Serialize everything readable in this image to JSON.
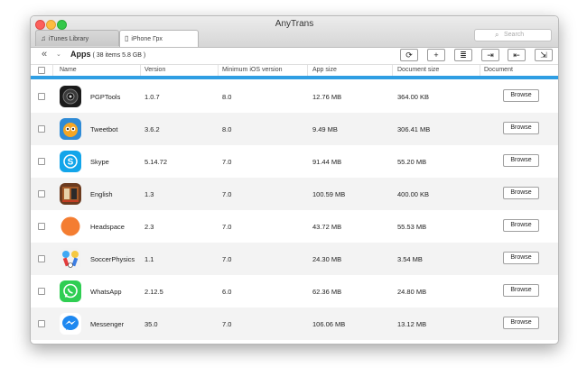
{
  "window": {
    "title": "AnyTrans"
  },
  "search": {
    "placeholder": "Search",
    "icon": "magnifier-icon"
  },
  "tabs": [
    {
      "label": "iTunes Library",
      "icon": "music-note-icon"
    },
    {
      "label": "iPhone Грх",
      "icon": "iphone-icon"
    }
  ],
  "toolbar": {
    "title": "Apps",
    "meta": "( 38 items  5.8 GB )",
    "buttons": [
      "refresh-icon",
      "add-icon",
      "list-icon",
      "import-icon",
      "export-icon",
      "transfer-icon"
    ]
  },
  "columns": [
    "Name",
    "Version",
    "Minimum iOS version",
    "App size",
    "Document size",
    "Document"
  ],
  "browse_label": "Browse",
  "accent_color": "#2f9ee3",
  "rows": [
    {
      "name": "PGPTools",
      "version": "1.0.7",
      "min_ios": "8.0",
      "app_size": "12.76 MB",
      "doc_size": "364.00 KB",
      "icon": "pgptools-icon"
    },
    {
      "name": "Tweetbot",
      "version": "3.6.2",
      "min_ios": "8.0",
      "app_size": "9.49 MB",
      "doc_size": "306.41 MB",
      "icon": "tweetbot-icon"
    },
    {
      "name": "Skype",
      "version": "5.14.72",
      "min_ios": "7.0",
      "app_size": "91.44 MB",
      "doc_size": "55.20 MB",
      "icon": "skype-icon"
    },
    {
      "name": "English",
      "version": "1.3",
      "min_ios": "7.0",
      "app_size": "100.59 MB",
      "doc_size": "400.00 KB",
      "icon": "english-icon"
    },
    {
      "name": "Headspace",
      "version": "2.3",
      "min_ios": "7.0",
      "app_size": "43.72 MB",
      "doc_size": "55.53 MB",
      "icon": "headspace-icon"
    },
    {
      "name": "SoccerPhysics",
      "version": "1.1",
      "min_ios": "7.0",
      "app_size": "24.30 MB",
      "doc_size": "3.54 MB",
      "icon": "soccerphysics-icon"
    },
    {
      "name": "WhatsApp",
      "version": "2.12.5",
      "min_ios": "6.0",
      "app_size": "62.36 MB",
      "doc_size": "24.80 MB",
      "icon": "whatsapp-icon"
    },
    {
      "name": "Messenger",
      "version": "35.0",
      "min_ios": "7.0",
      "app_size": "106.06 MB",
      "doc_size": "13.12 MB",
      "icon": "messenger-icon"
    }
  ]
}
